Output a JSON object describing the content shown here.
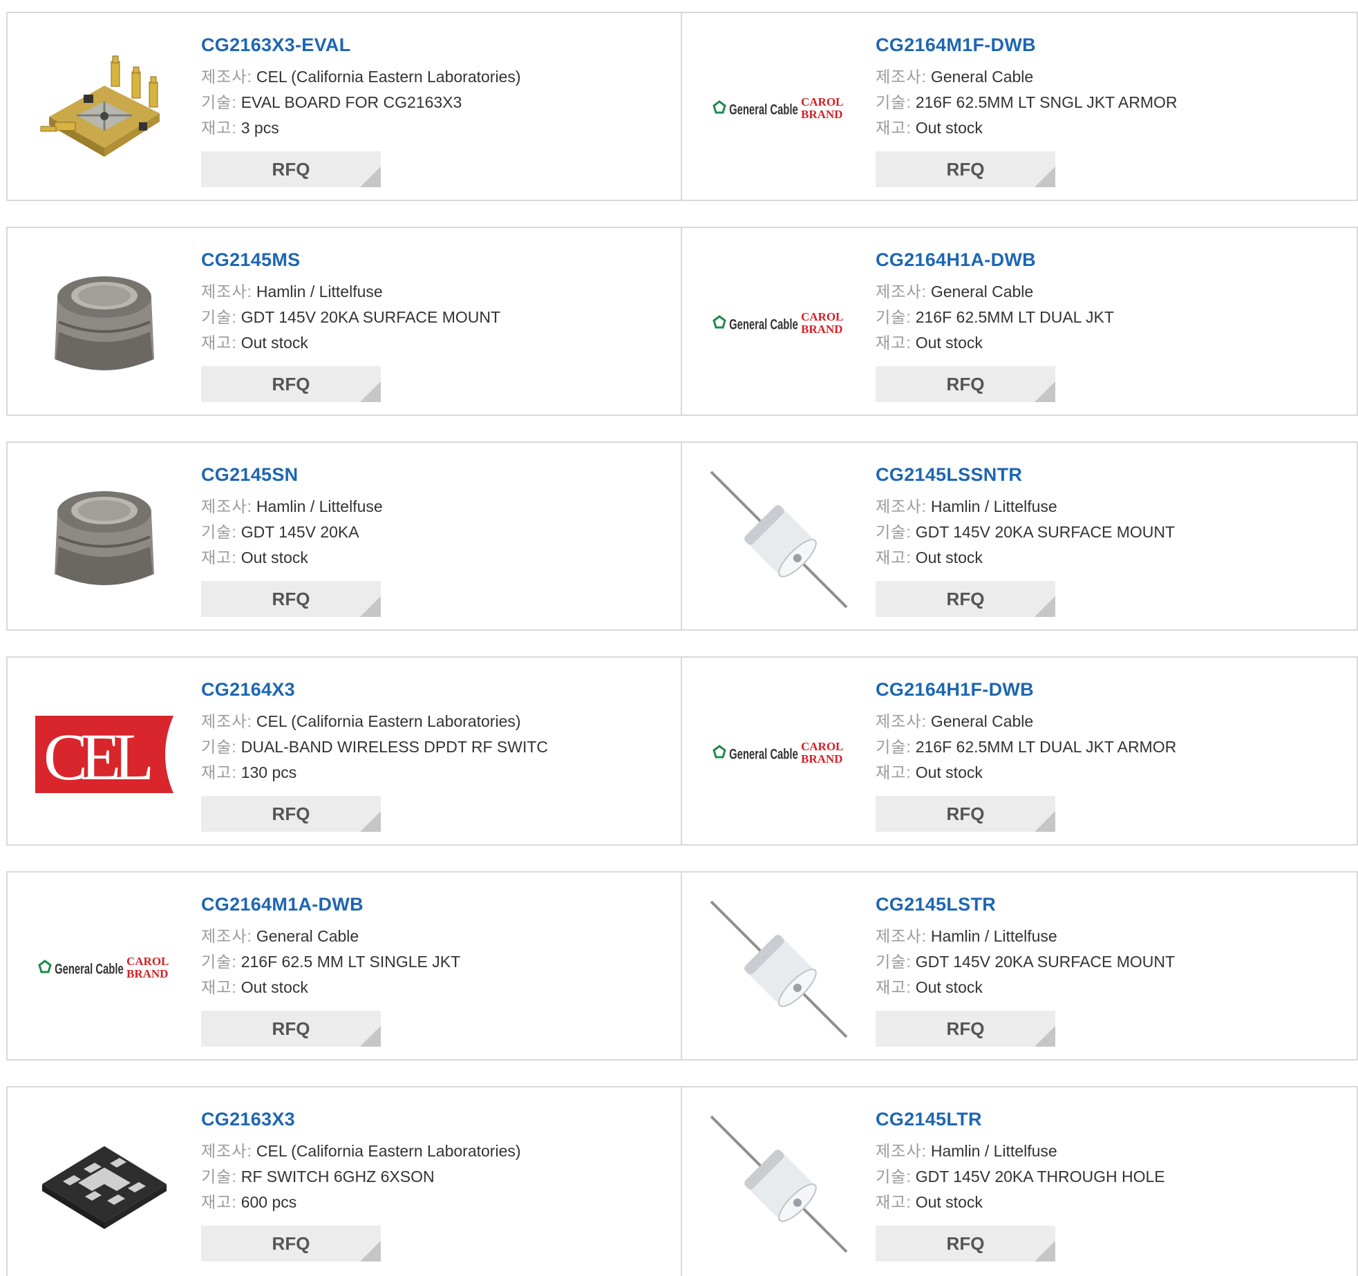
{
  "labels": {
    "manufacturer": "제조사:",
    "description": "기술:",
    "stock": "재고:",
    "rfq": "RFQ"
  },
  "products": [
    {
      "part": "CG2163X3-EVAL",
      "manufacturer": "CEL (California Eastern Laboratories)",
      "description": "EVAL BOARD FOR CG2163X3",
      "stock": "3 pcs",
      "image": "eval-board-image"
    },
    {
      "part": "CG2164M1F-DWB",
      "manufacturer": "General Cable",
      "description": "216F 62.5MM LT SNGL JKT ARMOR",
      "stock": "Out stock",
      "image": "general-cable-logo"
    },
    {
      "part": "CG2145MS",
      "manufacturer": "Hamlin / Littelfuse",
      "description": "GDT 145V 20KA SURFACE MOUNT",
      "stock": "Out stock",
      "image": "gdt-smd-image"
    },
    {
      "part": "CG2164H1A-DWB",
      "manufacturer": "General Cable",
      "description": "216F 62.5MM LT DUAL JKT",
      "stock": "Out stock",
      "image": "general-cable-logo"
    },
    {
      "part": "CG2145SN",
      "manufacturer": "Hamlin / Littelfuse",
      "description": "GDT 145V 20KA",
      "stock": "Out stock",
      "image": "gdt-smd-image"
    },
    {
      "part": "CG2145LSSNTR",
      "manufacturer": "Hamlin / Littelfuse",
      "description": "GDT 145V 20KA SURFACE MOUNT",
      "stock": "Out stock",
      "image": "gdt-leaded-image"
    },
    {
      "part": "CG2164X3",
      "manufacturer": "CEL (California Eastern Laboratories)",
      "description": "DUAL-BAND WIRELESS DPDT RF SWITC",
      "stock": "130 pcs",
      "image": "cel-logo"
    },
    {
      "part": "CG2164H1F-DWB",
      "manufacturer": "General Cable",
      "description": "216F 62.5MM LT DUAL JKT ARMOR",
      "stock": "Out stock",
      "image": "general-cable-logo"
    },
    {
      "part": "CG2164M1A-DWB",
      "manufacturer": "General Cable",
      "description": "216F 62.5 MM LT SINGLE JKT",
      "stock": "Out stock",
      "image": "general-cable-logo"
    },
    {
      "part": "CG2145LSTR",
      "manufacturer": "Hamlin / Littelfuse",
      "description": "GDT 145V 20KA SURFACE MOUNT",
      "stock": "Out stock",
      "image": "gdt-leaded-image"
    },
    {
      "part": "CG2163X3",
      "manufacturer": "CEL (California Eastern Laboratories)",
      "description": "RF SWITCH 6GHZ 6XSON",
      "stock": "600 pcs",
      "image": "xson-package-image"
    },
    {
      "part": "CG2145LTR",
      "manufacturer": "Hamlin / Littelfuse",
      "description": "GDT 145V 20KA THROUGH HOLE",
      "stock": "Out stock",
      "image": "gdt-leaded-image"
    }
  ],
  "logo_text": {
    "general_cable": "General Cable",
    "carol_1": "CAROL",
    "carol_2": "BRAND",
    "cel": "CEL"
  },
  "colors": {
    "part_link": "#1e66b2",
    "cel_red": "#d9262c",
    "carol_red": "#d32027",
    "gc_green": "#1f8a4c"
  }
}
